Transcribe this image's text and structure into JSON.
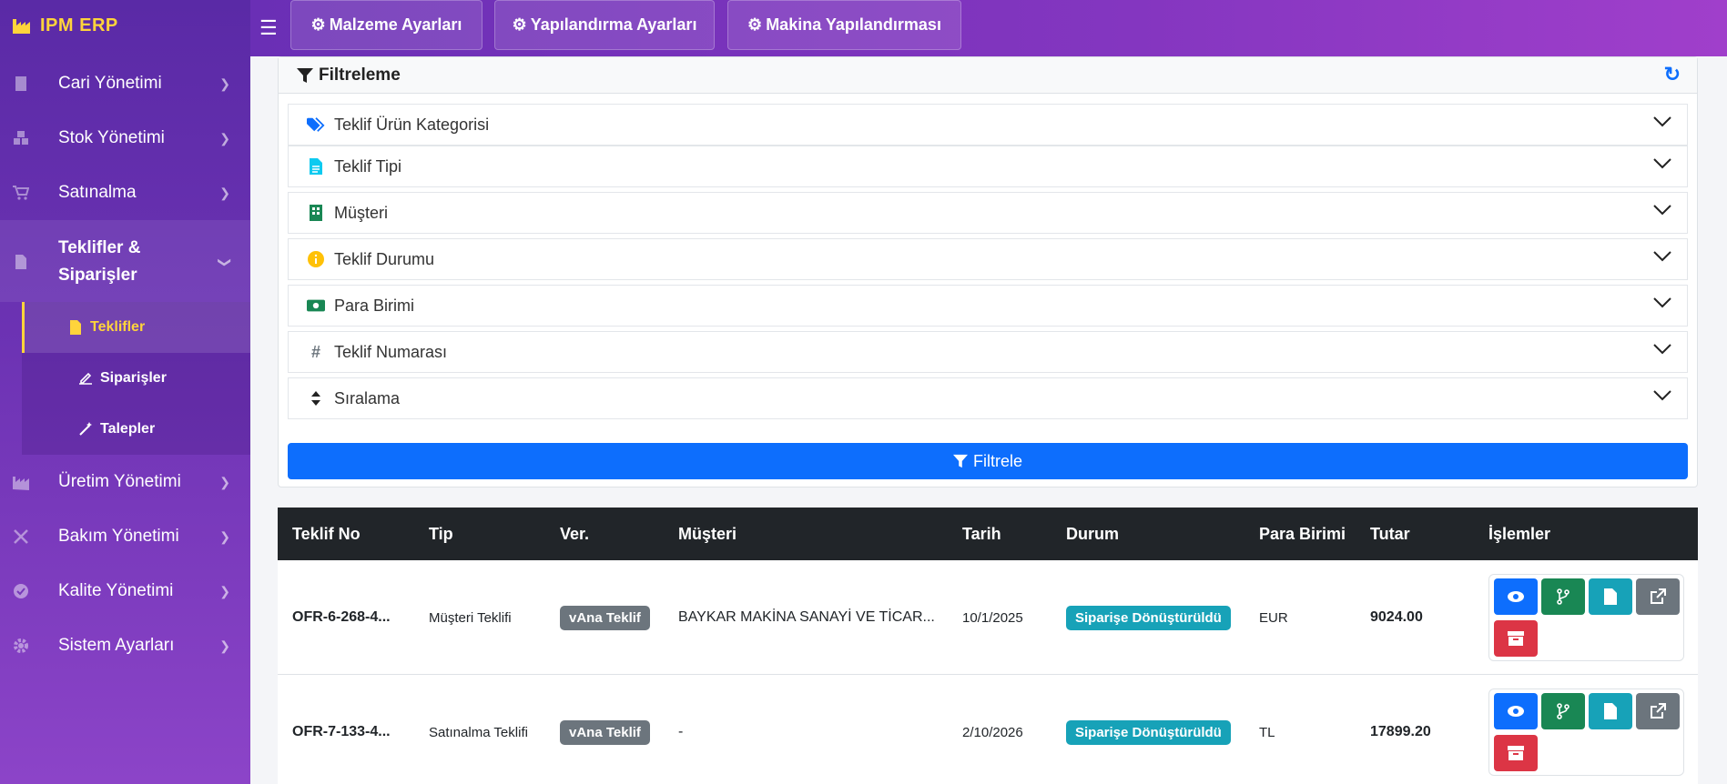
{
  "app": {
    "brand": "IPM ERP"
  },
  "sidebar": {
    "items": [
      {
        "label": "Cari Yönetimi",
        "icon": "building-icon"
      },
      {
        "label": "Stok Yönetimi",
        "icon": "boxes-icon"
      },
      {
        "label": "Satınalma",
        "icon": "cart-icon"
      },
      {
        "label_line1": "Teklifler &",
        "label_line2": "Siparişler",
        "icon": "file-invoice-icon"
      },
      {
        "label": "Üretim Yönetimi",
        "icon": "industry-icon"
      },
      {
        "label": "Bakım Yönetimi",
        "icon": "tools-icon"
      },
      {
        "label": "Kalite Yönetimi",
        "icon": "check-circle-icon"
      },
      {
        "label": "Sistem Ayarları",
        "icon": "gear-icon"
      }
    ],
    "submenu": [
      {
        "label": "Teklifler",
        "icon": "file-icon",
        "active": true
      },
      {
        "label": "Siparişler",
        "icon": "signature-icon"
      },
      {
        "label": "Talepler",
        "icon": "magic-icon"
      }
    ]
  },
  "topbar": {
    "buttons": [
      {
        "label": "Malzeme Ayarları",
        "icon": "cubes-icon"
      },
      {
        "label": "Yapılandırma Ayarları",
        "icon": "gear-icon"
      },
      {
        "label": "Makina Yapılandırması",
        "icon": "gears-icon"
      }
    ]
  },
  "filter": {
    "title": "Filtreleme",
    "sections": [
      {
        "label": "Teklif Ürün Kategorisi",
        "icon": "tags-icon"
      },
      {
        "label": "Teklif Tipi",
        "icon": "file-alt-icon"
      },
      {
        "label": "Müşteri",
        "icon": "building-icon"
      },
      {
        "label": "Teklif Durumu",
        "icon": "info-circle-icon"
      },
      {
        "label": "Para Birimi",
        "icon": "money-icon"
      },
      {
        "label": "Teklif Numarası",
        "icon": "hash-icon"
      },
      {
        "label": "Sıralama",
        "icon": "sort-icon"
      }
    ],
    "button_label": "Filtrele"
  },
  "table": {
    "headers": [
      "Teklif No",
      "Tip",
      "Ver.",
      "Müşteri",
      "Tarih",
      "Durum",
      "Para Birimi",
      "Tutar",
      "İşlemler"
    ],
    "rows": [
      {
        "no": "OFR-6-268-4...",
        "tip": "Müşteri Teklifi",
        "ver": "vAna Teklif",
        "musteri": "BAYKAR MAKİNA SANAYİ VE TİCAR...",
        "tarih": "10/1/2025",
        "durum": "Siparişe Dönüştürüldü",
        "para": "EUR",
        "tutar": "9024.00"
      },
      {
        "no": "OFR-7-133-4...",
        "tip": "Satınalma Teklifi",
        "ver": "vAna Teklif",
        "musteri": "-",
        "tarih": "2/10/2026",
        "durum": "Siparişe Dönüştürüldü",
        "para": "TL",
        "tutar": "17899.20"
      }
    ]
  },
  "colors": {
    "accent": "#0d6efd",
    "brand_yellow": "#ffd43b",
    "sidebar": "#6d33b4"
  }
}
